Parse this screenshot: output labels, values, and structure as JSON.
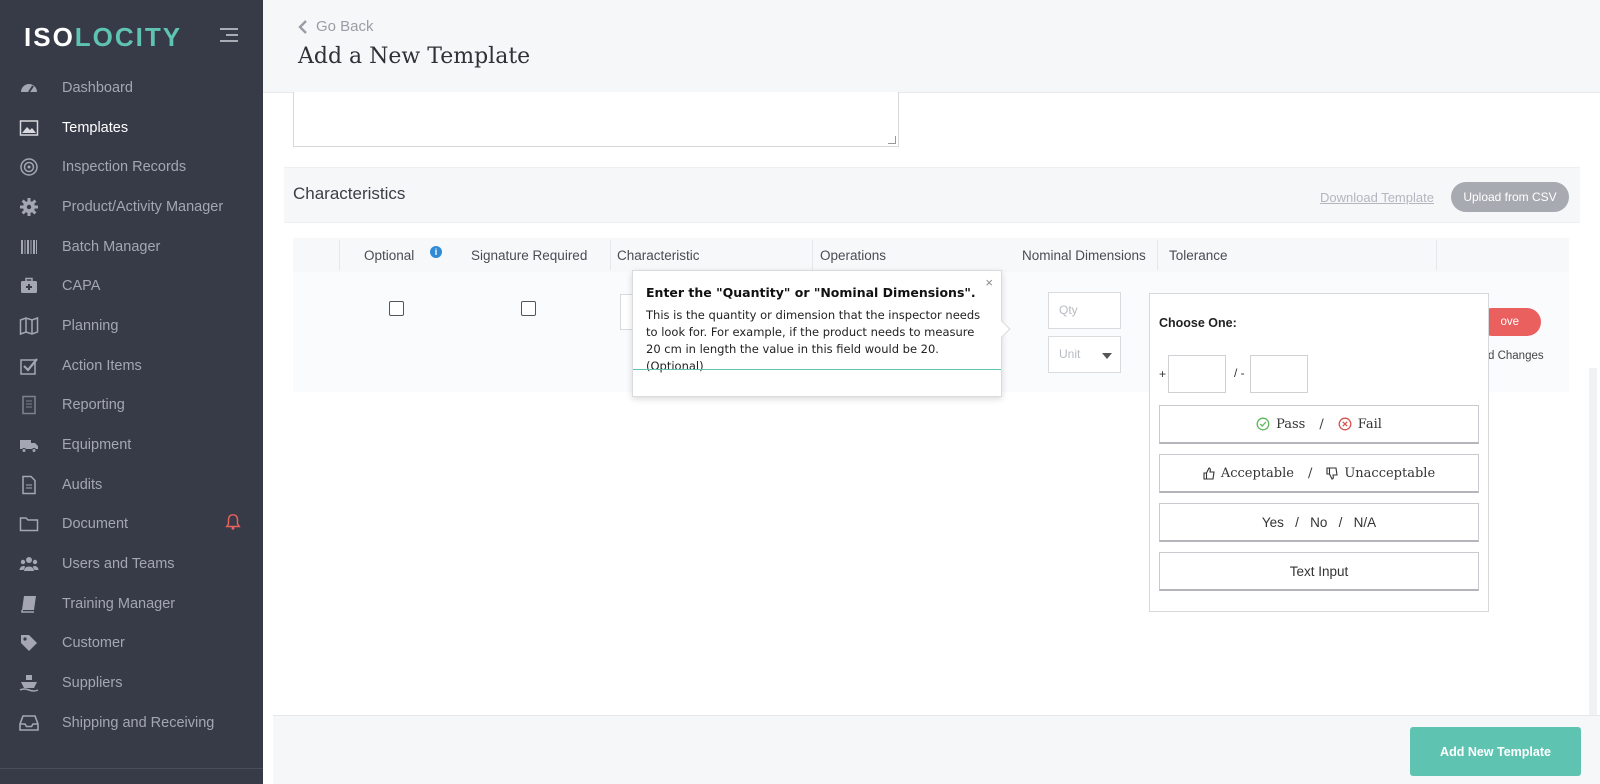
{
  "logo": {
    "part1": "ISO",
    "part2": "LOCITY"
  },
  "sidebar": {
    "items": [
      {
        "label": "Dashboard",
        "icon": "dashboard-icon"
      },
      {
        "label": "Templates",
        "icon": "image-icon",
        "active": true
      },
      {
        "label": "Inspection Records",
        "icon": "target-icon"
      },
      {
        "label": "Product/Activity Manager",
        "icon": "gear-icon"
      },
      {
        "label": "Batch Manager",
        "icon": "barcode-icon"
      },
      {
        "label": "CAPA",
        "icon": "medkit-icon"
      },
      {
        "label": "Planning",
        "icon": "map-icon"
      },
      {
        "label": "Action Items",
        "icon": "checkbox-icon"
      },
      {
        "label": "Reporting",
        "icon": "report-icon"
      },
      {
        "label": "Equipment",
        "icon": "truck-icon"
      },
      {
        "label": "Audits",
        "icon": "file-icon"
      },
      {
        "label": "Document",
        "icon": "folder-icon"
      },
      {
        "label": "Users and Teams",
        "icon": "users-icon"
      },
      {
        "label": "Training Manager",
        "icon": "book-icon"
      },
      {
        "label": "Customer",
        "icon": "tag-icon"
      },
      {
        "label": "Suppliers",
        "icon": "ship-icon"
      },
      {
        "label": "Shipping and Receiving",
        "icon": "inbox-icon"
      }
    ],
    "alert_color": "#e9605f"
  },
  "header": {
    "back_label": "Go Back",
    "title": "Add a New Template"
  },
  "characteristics": {
    "title": "Characteristics",
    "download_link": "Download Template",
    "upload_button": "Upload from CSV",
    "columns": [
      "Optional",
      "Signature Required",
      "Characteristic",
      "Operations",
      "Nominal Dimensions",
      "Tolerance"
    ],
    "qty_placeholder": "Qty",
    "unit_placeholder": "Unit",
    "remove_label": "ove",
    "unsaved_label": "d Changes"
  },
  "tooltip": {
    "title": "Enter the \"Quantity\" or \"Nominal Dimensions\".",
    "body": "This is the quantity or dimension that the inspector needs to look for. For example, if the product needs to measure 20 cm in length the value in this field would be 20. (Optional)",
    "close": "×"
  },
  "tolerance": {
    "choose_label": "Choose One:",
    "plus_label": "+",
    "minus_label": "/ -",
    "options": {
      "pass": "Pass",
      "fail": "Fail",
      "acceptable": "Acceptable",
      "unacceptable": "Unacceptable",
      "yes_no_na": "Yes   /   No   /   N/A",
      "text_input": "Text Input"
    },
    "sep": "/"
  },
  "footer": {
    "add_button": "Add New Template"
  },
  "colors": {
    "accent": "#5fc3b2",
    "sidebar_bg": "#373a47",
    "danger": "#e9605f"
  }
}
